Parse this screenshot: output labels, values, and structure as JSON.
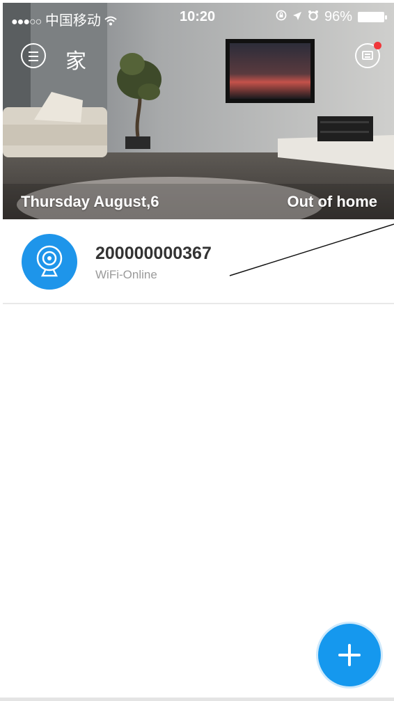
{
  "status_bar": {
    "signal": "●●●○○",
    "carrier": "中国移动",
    "wifi_icon": "wifi-icon",
    "time": "10:20",
    "battery_percent": "96%",
    "battery_level": 0.96
  },
  "header": {
    "title": "家",
    "menu_icon": "menu-icon",
    "message_icon": "message-icon",
    "has_unread": true
  },
  "hero": {
    "date": "Thursday August,6",
    "mode": "Out of home"
  },
  "devices": [
    {
      "name": "200000000367",
      "status": "WiFi-Online",
      "icon": "camera-icon"
    }
  ],
  "fab": {
    "icon": "plus-icon"
  },
  "colors": {
    "accent": "#1e95ea",
    "badge": "#f0373a",
    "muted_text": "#9a9a9a"
  }
}
